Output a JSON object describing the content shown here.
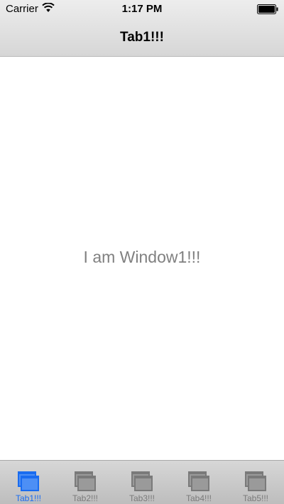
{
  "status_bar": {
    "carrier": "Carrier",
    "time": "1:17 PM"
  },
  "nav": {
    "title": "Tab1!!!"
  },
  "content": {
    "label": "I am Window1!!!"
  },
  "tabs": [
    {
      "label": "Tab1!!!",
      "active": true,
      "icon": "window-stack-icon"
    },
    {
      "label": "Tab2!!!",
      "active": false,
      "icon": "window-stack-icon"
    },
    {
      "label": "Tab3!!!",
      "active": false,
      "icon": "window-stack-icon"
    },
    {
      "label": "Tab4!!!",
      "active": false,
      "icon": "window-stack-icon"
    },
    {
      "label": "Tab5!!!",
      "active": false,
      "icon": "window-stack-icon"
    }
  ],
  "colors": {
    "active_tab": "#1a6cf0",
    "inactive_tab": "#7a7a7a",
    "content_text": "#808080"
  }
}
